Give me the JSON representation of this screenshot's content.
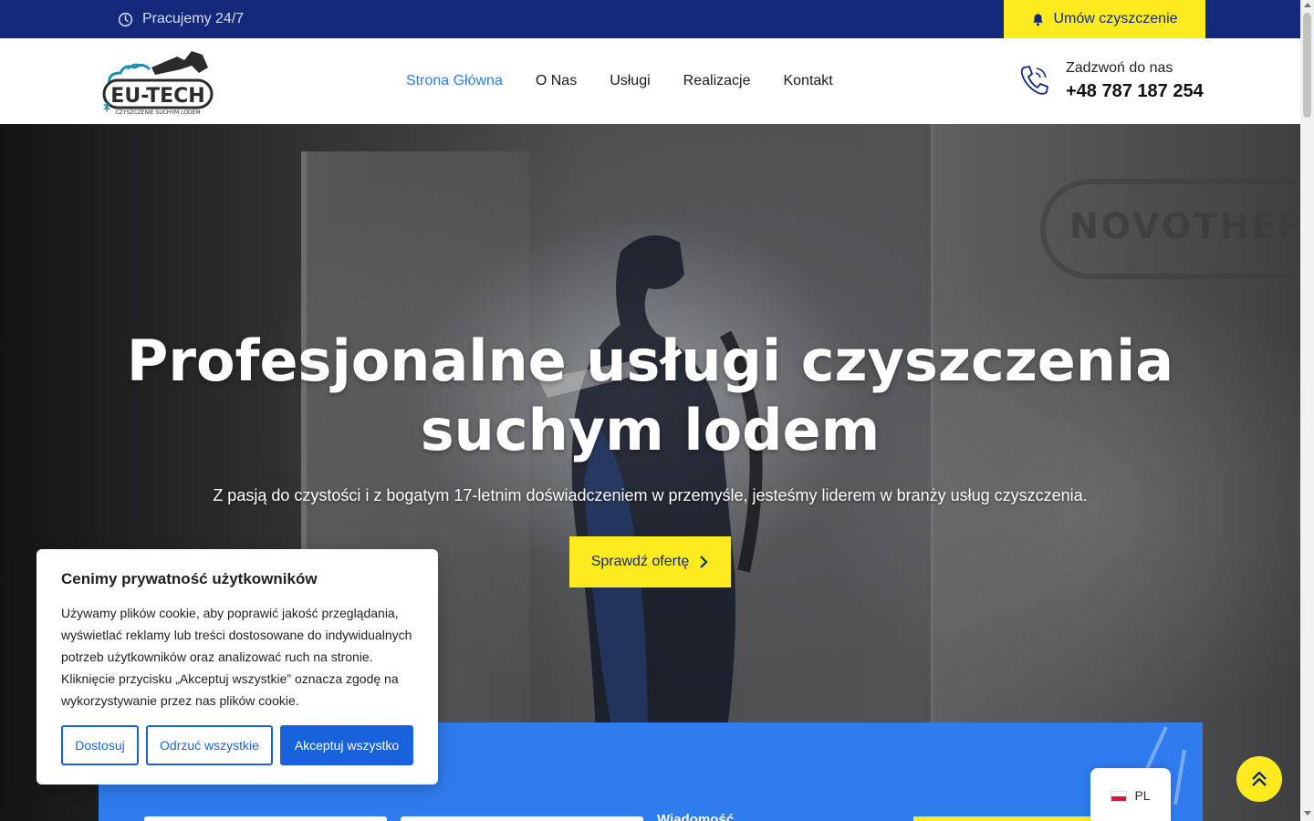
{
  "topbar": {
    "hours_text": "Pracujemy 24/7",
    "book_button": "Umów czyszczenie",
    "icons": {
      "hours": "clock-icon",
      "book": "bell-icon"
    }
  },
  "header": {
    "logo": {
      "name": "EU-TECH",
      "tagline": "CZYSZCZENIE SUCHYM LODEM"
    },
    "nav": [
      {
        "label": "Strona Główna",
        "active": true
      },
      {
        "label": "O Nas",
        "active": false
      },
      {
        "label": "Usługi",
        "active": false
      },
      {
        "label": "Realizacje",
        "active": false
      },
      {
        "label": "Kontakt",
        "active": false
      }
    ],
    "call": {
      "label": "Zadzwoń do nas",
      "number": "+48 787 187 254",
      "icon": "phone-icon"
    }
  },
  "hero": {
    "title_line1": "Profesjonalne usługi czyszczenia",
    "title_line2": "suchym lodem",
    "subtitle": "Z pasją do czystości i z bogatym 17-letnim doświadczeniem w przemyśle, jesteśmy liderem w branży usług czyszczenia.",
    "cta": "Sprawdź ofertę",
    "background_text": "NOVOTHERM"
  },
  "form_band": {
    "message_label": "Wiadomość"
  },
  "cookie": {
    "title": "Cenimy prywatność użytkowników",
    "text": "Używamy plików cookie, aby poprawić jakość przeglądania, wyświetlać reklamy lub treści dostosowane do indywidualnych potrzeb użytkowników oraz analizować ruch na stronie. Kliknięcie przycisku „Akceptuj wszystkie” oznacza zgodę na wykorzystywanie przez nas plików cookie.",
    "customize": "Dostosuj",
    "reject": "Odrzuć wszystkie",
    "accept": "Akceptuj wszystko"
  },
  "language": {
    "code": "PL"
  },
  "colors": {
    "topbar": "#15297c",
    "accent_yellow": "#fdeb1f",
    "nav_active": "#2f7de1",
    "form_blue": "#2f7cef",
    "cookie_blue": "#1863dc"
  }
}
